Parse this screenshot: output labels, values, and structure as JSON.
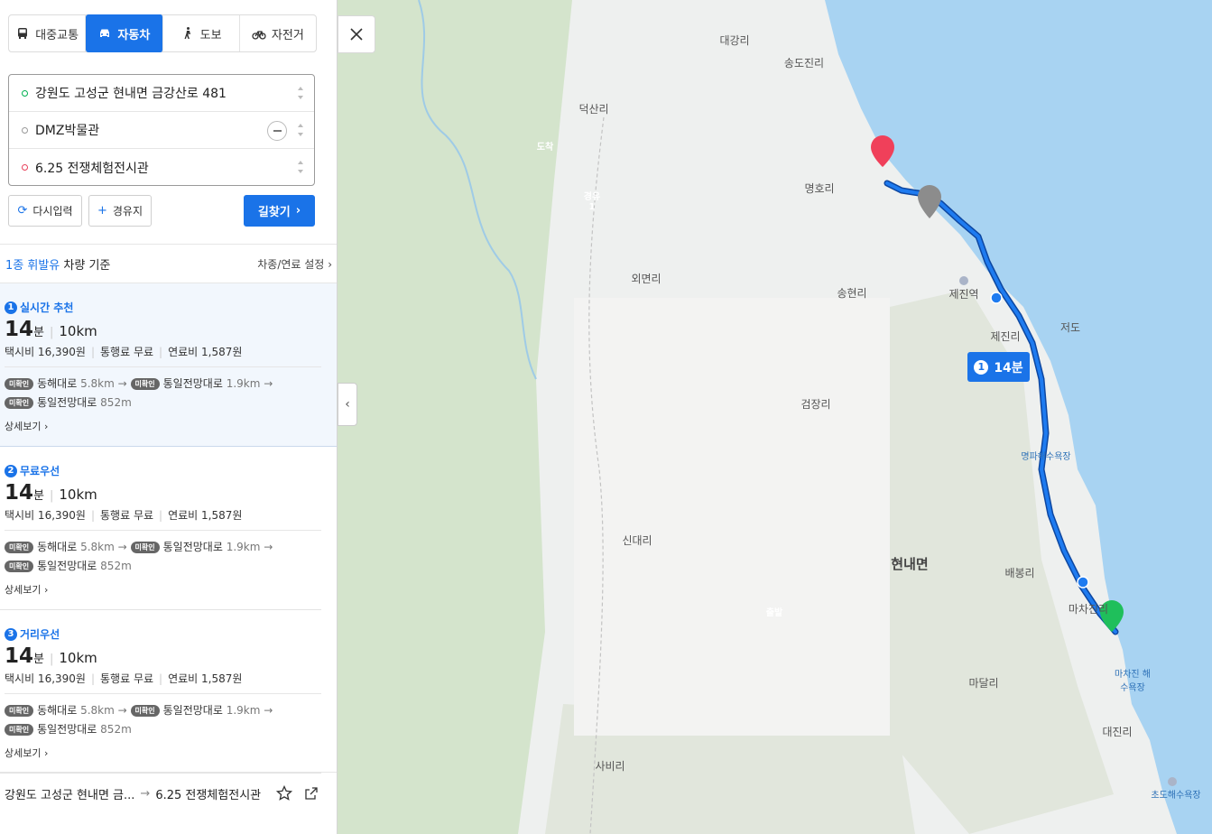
{
  "modes": [
    {
      "label": "대중교통",
      "icon": "bus-icon",
      "active": false
    },
    {
      "label": "자동차",
      "icon": "car-icon",
      "active": true
    },
    {
      "label": "도보",
      "icon": "walk-icon",
      "active": false
    },
    {
      "label": "자전거",
      "icon": "bike-icon",
      "active": false
    }
  ],
  "route": {
    "origin": "강원도 고성군 현내면 금강산로 481",
    "waypoint": "DMZ박물관",
    "destination": "6.25 전쟁체험전시관"
  },
  "buttons": {
    "reset": "다시입력",
    "waypoint": "경유지",
    "search": "길찾기"
  },
  "vehicle": {
    "type": "1종 휘발유",
    "suffix": "차량 기준",
    "settings": "차종/연료 설정"
  },
  "options": [
    {
      "num": "1",
      "title": "실시간 추천",
      "time_num": "14",
      "time_unit": "분",
      "distance": "10km",
      "taxi": "택시비 16,390원",
      "toll": "통행료 무료",
      "fuel": "연료비 1,587원",
      "tag": "미확인",
      "road1": "동해대로",
      "road1_dist": "5.8km",
      "road2": "통일전망대로",
      "road2_dist": "1.9km",
      "road3": "통일전망대로",
      "road3_dist": "852m",
      "detail": "상세보기"
    },
    {
      "num": "2",
      "title": "무료우선",
      "time_num": "14",
      "time_unit": "분",
      "distance": "10km",
      "taxi": "택시비 16,390원",
      "toll": "통행료 무료",
      "fuel": "연료비 1,587원",
      "tag": "미확인",
      "road1": "동해대로",
      "road1_dist": "5.8km",
      "road2": "통일전망대로",
      "road2_dist": "1.9km",
      "road3": "통일전망대로",
      "road3_dist": "852m",
      "detail": "상세보기"
    },
    {
      "num": "3",
      "title": "거리우선",
      "time_num": "14",
      "time_unit": "분",
      "distance": "10km",
      "taxi": "택시비 16,390원",
      "toll": "통행료 무료",
      "fuel": "연료비 1,587원",
      "tag": "미확인",
      "road1": "동해대로",
      "road1_dist": "5.8km",
      "road2": "통일전망대로",
      "road2_dist": "1.9km",
      "road3": "통일전망대로",
      "road3_dist": "852m",
      "detail": "상세보기"
    }
  ],
  "footer": {
    "from": "강원도 고성군 현내면 금...",
    "to": "6.25 전쟁체험전시관"
  },
  "map": {
    "labels": [
      "대강리",
      "송도진리",
      "덕산리",
      "명호리",
      "외면리",
      "송현리",
      "제진역",
      "제진리",
      "저도",
      "검장리",
      "명파해수욕장",
      "신대리",
      "현내면",
      "배봉리",
      "마차진리",
      "마달리",
      "마차진 해수욕장",
      "대진리",
      "사비리",
      "초도해수욕장"
    ],
    "route_badge": {
      "num": "1",
      "time": "14분"
    },
    "pins": {
      "end": "도착",
      "via": "경유 1",
      "start": "출발"
    },
    "colors": {
      "route": "#1565d8",
      "sea": "#a8d3f2",
      "land": "#eef0ef",
      "forest": "#d4e4cc",
      "start": "#1fbf5b",
      "end": "#f0405a",
      "via": "#8c8c8c"
    }
  }
}
